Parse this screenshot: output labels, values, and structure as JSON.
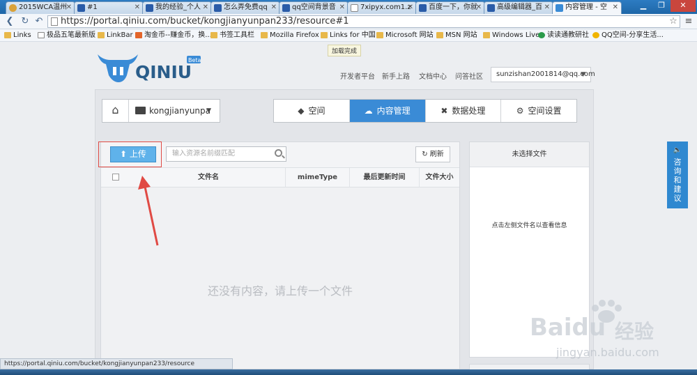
{
  "browser": {
    "tabs": [
      {
        "label": "2015WCA温州"
      },
      {
        "label": "#1"
      },
      {
        "label": "我的经验_个人"
      },
      {
        "label": "怎么弄免费qq"
      },
      {
        "label": "qq空间背景音"
      },
      {
        "label": "7xipyx.com1.z"
      },
      {
        "label": "百度一下，你就"
      },
      {
        "label": "高级编辑器_百"
      },
      {
        "label": "内容管理 - 空"
      }
    ],
    "url": "https://portal.qiniu.com/bucket/kongjianyunpan233/resource#1",
    "bookmarks": [
      {
        "label": "Links"
      },
      {
        "label": "极品五笔最新版"
      },
      {
        "label": "LinkBar"
      },
      {
        "label": "淘金币--赚金币，换..."
      },
      {
        "label": "书签工具栏"
      },
      {
        "label": "Mozilla Firefox"
      },
      {
        "label": "Links for 中国"
      },
      {
        "label": "Microsoft 网站"
      },
      {
        "label": "MSN 网站"
      },
      {
        "label": "Windows Live"
      },
      {
        "label": "读读通教研社"
      },
      {
        "label": "QQ空间-分享生活..."
      }
    ],
    "tooltip": "加载完成",
    "status_url": "https://portal.qiniu.com/bucket/kongjianyunpan233/resource"
  },
  "header": {
    "logo_text": "QINIU",
    "logo_badge": "Beta",
    "links": [
      "开发者平台",
      "新手上路",
      "文档中心",
      "问答社区"
    ],
    "account": "sunzishan2001814@qq.com"
  },
  "bucket": {
    "name": "kongjianyunpa"
  },
  "nav_tabs": [
    {
      "label": "空间",
      "icon": "cube-icon"
    },
    {
      "label": "内容管理",
      "icon": "cloud-upload-icon",
      "active": true
    },
    {
      "label": "数据处理",
      "icon": "tools-icon"
    },
    {
      "label": "空间设置",
      "icon": "gear-icon"
    }
  ],
  "toolbar": {
    "upload_label": "上传",
    "search_placeholder": "输入资源名前缀匹配",
    "refresh_label": "刷新"
  },
  "table": {
    "columns": [
      "文件名",
      "mimeType",
      "最后更新时间",
      "文件大小"
    ],
    "empty_message": "还没有内容，请上传一个文件"
  },
  "detail": {
    "title": "未选择文件",
    "message": "点击左侧文件名以查看信息"
  },
  "feedback": {
    "label_chars": [
      "咨",
      "询",
      "和",
      "建",
      "议"
    ]
  },
  "watermark": {
    "brand": "Bai",
    "brand2": "du",
    "product": "经验",
    "url": "jingyan.baidu.com"
  },
  "colors": {
    "accent": "#3a8bd6",
    "upload_button": "#5fb2ea",
    "highlight_border": "#e04a44",
    "logo": "#3a8bd6"
  }
}
